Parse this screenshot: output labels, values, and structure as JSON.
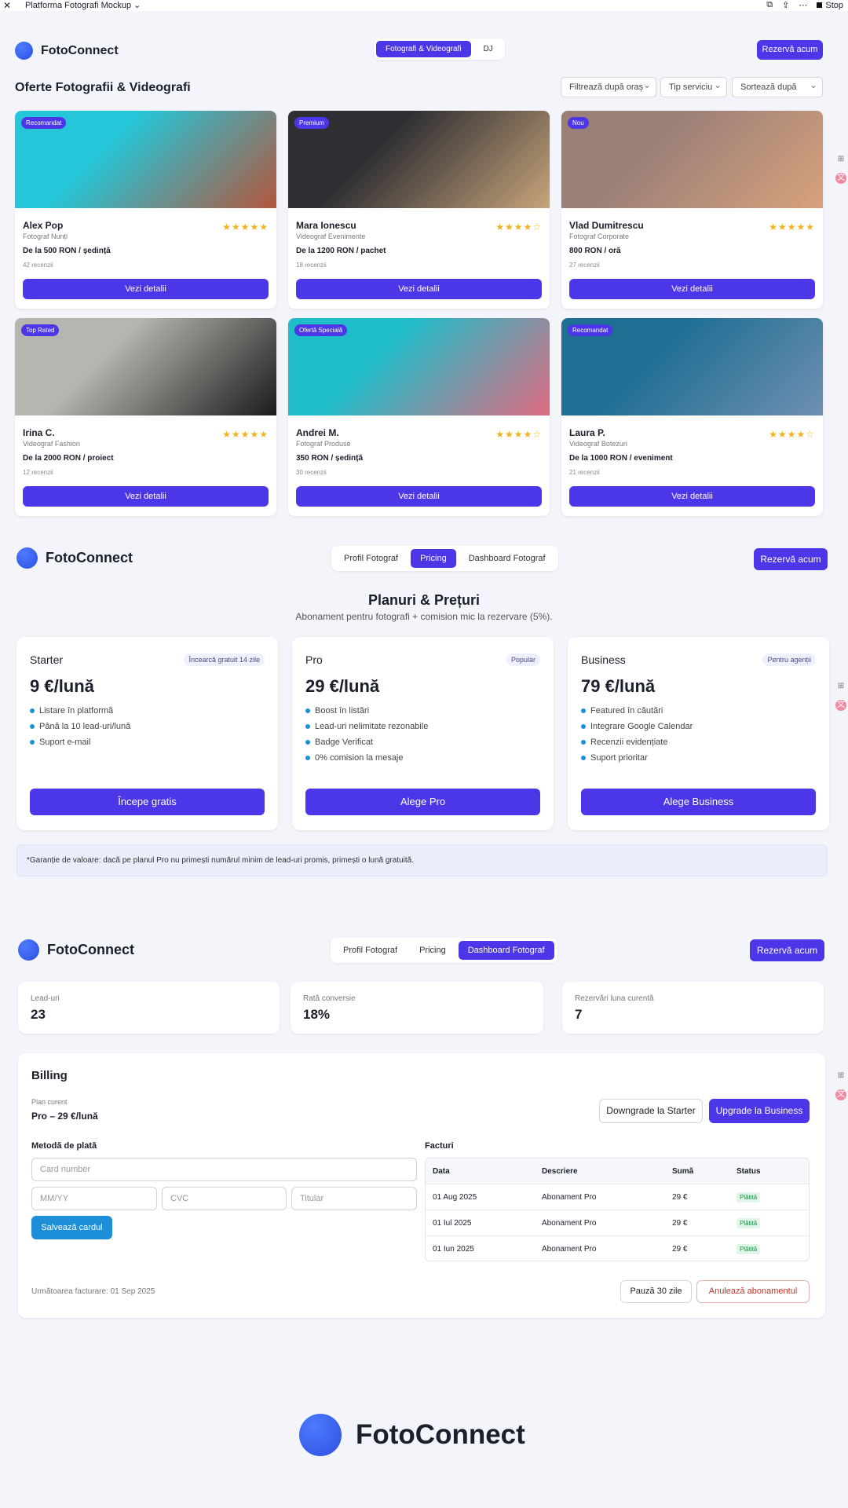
{
  "window": {
    "title": "Platforma Fotografi Mockup",
    "stop": "Stop"
  },
  "brand": "FotoConnect",
  "top": {
    "tabs": [
      "Fotografi & Videografi",
      "DJ"
    ],
    "book": "Rezervă acum",
    "heading": "Oferte Fotografii & Videografi",
    "filters": [
      "Filtrează după oraș",
      "Tip serviciu",
      "Sortează după"
    ],
    "cards": [
      {
        "badge": "Recomandat",
        "name": "Alex Pop",
        "role": "Fotograf Nunți",
        "price": "De la 500 RON / ședință",
        "reviews": "42 recenzii",
        "rating": 5,
        "stars": "★★★★★",
        "cta": "Vezi detalii",
        "c1": "#25c6d9",
        "c2": "#b4563c"
      },
      {
        "badge": "Premium",
        "name": "Mara Ionescu",
        "role": "Videograf Evenimente",
        "price": "De la 1200 RON / pachet",
        "reviews": "18 recenzii",
        "rating": 4,
        "stars": "★★★★☆",
        "cta": "Vezi detalii",
        "c1": "#2f2f33",
        "c2": "#c7a47a"
      },
      {
        "badge": "Nou",
        "name": "Vlad Dumitrescu",
        "role": "Fotograf Corporate",
        "price": "800 RON / oră",
        "reviews": "27 recenzii",
        "rating": 5,
        "stars": "★★★★★",
        "cta": "Vezi detalii",
        "c1": "#9b8078",
        "c2": "#d8a27c"
      },
      {
        "badge": "Top Rated",
        "name": "Irina C.",
        "role": "Videograf Fashion",
        "price": "De la 2000 RON / proiect",
        "reviews": "12 recenzii",
        "rating": 5,
        "stars": "★★★★★",
        "cta": "Vezi detalii",
        "c1": "#b7b5b0",
        "c2": "#1b1b1b"
      },
      {
        "badge": "Ofertă Specială",
        "name": "Andrei M.",
        "role": "Fotograf Produse",
        "price": "350 RON / ședință",
        "reviews": "30 recenzii",
        "rating": 4,
        "stars": "★★★★☆",
        "cta": "Vezi detalii",
        "c1": "#1fbcc9",
        "c2": "#e06a80"
      },
      {
        "badge": "Recomandat",
        "name": "Laura P.",
        "role": "Videograf Botezuri",
        "price": "De la 1000 RON / eveniment",
        "reviews": "21 recenzii",
        "rating": 4,
        "stars": "★★★★☆",
        "cta": "Vezi detalii",
        "c1": "#1f6f94",
        "c2": "#6e8fb0"
      }
    ]
  },
  "nav_tabs": [
    "Profil Fotograf",
    "Pricing",
    "Dashboard Fotograf"
  ],
  "pricing": {
    "title": "Planuri & Prețuri",
    "subtitle": "Abonament pentru fotografi + comision mic la rezervare (5%).",
    "plans": [
      {
        "name": "Starter",
        "tag": "Încearcă gratuit 14 zile",
        "price": "9 €/lună",
        "features": [
          "Listare în platformă",
          "Până la 10 lead-uri/lună",
          "Suport e-mail"
        ],
        "cta": "Începe gratis"
      },
      {
        "name": "Pro",
        "tag": "Popular",
        "price": "29 €/lună",
        "features": [
          "Boost în listări",
          "Lead-uri nelimitate rezonabile",
          "Badge Verificat",
          "0% comision la mesaje"
        ],
        "cta": "Alege Pro"
      },
      {
        "name": "Business",
        "tag": "Pentru agenții",
        "price": "79 €/lună",
        "features": [
          "Featured în căutări",
          "Integrare Google Calendar",
          "Recenzii evidențiate",
          "Suport prioritar"
        ],
        "cta": "Alege Business"
      }
    ],
    "guarantee": "*Garanție de valoare: dacă pe planul Pro nu primești numărul minim de lead-uri promis, primești o lună gratuită."
  },
  "dashboard": {
    "stats": [
      {
        "label": "Lead-uri",
        "value": "23"
      },
      {
        "label": "Rată conversie",
        "value": "18%"
      },
      {
        "label": "Rezervări luna curentă",
        "value": "7"
      }
    ],
    "billing": "Billing",
    "plan_label": "Plan curent",
    "plan_value": "Pro – 29 €/lună",
    "downgrade": "Downgrade la Starter",
    "upgrade": "Upgrade la Business",
    "payment_title": "Metodă de plată",
    "card_ph": "Card number",
    "exp_ph": "MM/YY",
    "cvc_ph": "CVC",
    "holder_ph": "Titular",
    "save_card": "Salvează cardul",
    "invoices_title": "Facturi",
    "columns": [
      "Data",
      "Descriere",
      "Sumă",
      "Status"
    ],
    "invoices": [
      [
        "01 Aug 2025",
        "Abonament Pro",
        "29 €",
        "Plătită"
      ],
      [
        "01 Iul 2025",
        "Abonament Pro",
        "29 €",
        "Plătită"
      ],
      [
        "01 Iun 2025",
        "Abonament Pro",
        "29 €",
        "Plătită"
      ]
    ],
    "next_billing": "Următoarea facturare: 01 Sep 2025",
    "pause": "Pauză 30 zile",
    "cancel": "Anulează abonamentul"
  },
  "colors": {
    "accent": "#4b36e8",
    "save": "#1d8fd8",
    "paid": "#1f8b47",
    "cancel": "#c0352b"
  }
}
